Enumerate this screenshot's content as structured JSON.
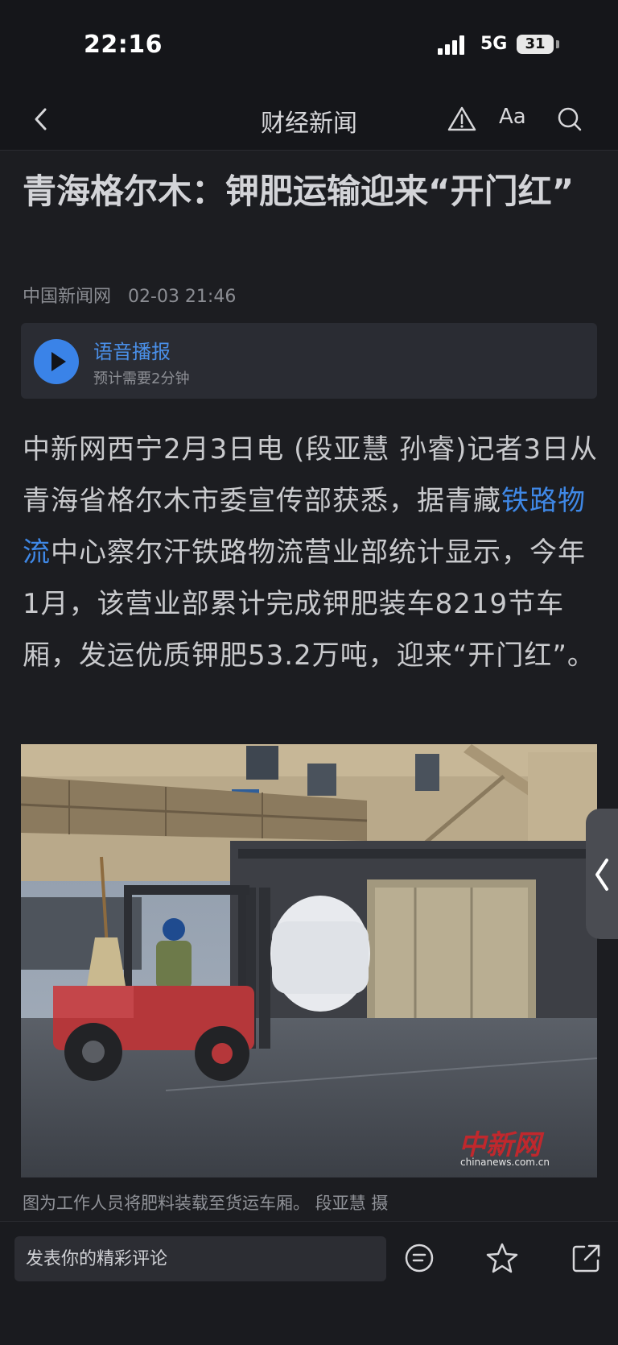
{
  "status": {
    "time": "22:16",
    "network": "5G",
    "battery": "31"
  },
  "nav": {
    "title": "财经新闻",
    "font_label": "Aa"
  },
  "article": {
    "title": "青海格尔木：钾肥运输迎来“开门红”",
    "source": "中国新闻网",
    "datetime": "02-03 21:46",
    "body_before": "中新网西宁2月3日电 (段亚慧 孙睿)记者3日从青海省格尔木市委宣传部获悉，据青藏",
    "body_link": "铁路物流",
    "body_after": "中心察尔汗铁路物流营业部统计显示，今年1月，该营业部累计完成钾肥装车8219节车厢，发运优质钾肥53.2万吨，迎来“开门红”。",
    "caption": "图为工作人员将肥料装载至货运车厢。 段亚慧 摄"
  },
  "audio": {
    "label": "语音播报",
    "duration": "预计需要2分钟"
  },
  "photo_watermark": {
    "brand": "中新网",
    "site": "chinanews.com.cn"
  },
  "bottom": {
    "comment_placeholder": "发表你的精彩评论"
  },
  "icons": {
    "back": "chevron-left-icon",
    "report": "warning-icon",
    "search": "search-icon",
    "comment": "comment-icon",
    "favorite": "star-icon",
    "share": "share-icon",
    "side_tab": "chevron-left-icon"
  },
  "colors": {
    "accent": "#3f88e6",
    "background": "#1c1d21"
  }
}
